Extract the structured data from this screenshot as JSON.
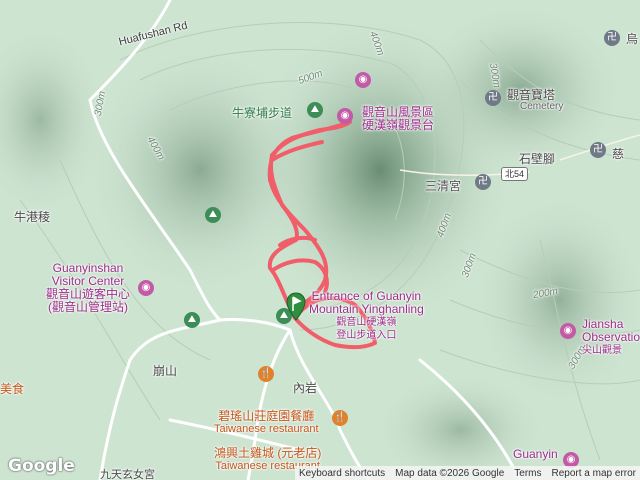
{
  "map": {
    "roads": [
      {
        "id": "huafushan",
        "label": "Huafushan Rd"
      },
      {
        "id": "north54",
        "label": "北54"
      }
    ],
    "contours": [
      "300m",
      "500m",
      "400m",
      "400m",
      "300m",
      "400m",
      "300m",
      "200m",
      "300m"
    ],
    "places": {
      "niugangleng": "牛港稜",
      "shibijiao": "石壁腳",
      "bengshan": "崩山",
      "neiyan": "內岩",
      "sanqinggong": "三清宮",
      "guanyin_baota": "觀音寶塔",
      "cemetery": "Cemetery",
      "niuliao_trail": "牛寮埔步道",
      "ci": "慈",
      "wu": "烏",
      "jiutian": "九天玄女宮",
      "mei": "美食"
    },
    "pois": {
      "scenic": [
        "觀音山風景區",
        "硬漢嶺觀景台"
      ],
      "visitor_center": [
        "Guanyinshan",
        "Visitor Center",
        "觀音山遊客中心",
        "(觀音山管理站)"
      ],
      "entrance": [
        "Entrance of Guanyin",
        "Mountain Yinghanling",
        "觀音山硬漢嶺",
        "登山步道入口"
      ],
      "jiansha": [
        "Jiansha",
        "Observatio",
        "尖山觀景"
      ],
      "guanyin_bottom": "Guanyin"
    },
    "restaurants": {
      "biyao": [
        "碧瑤山莊庭園餐廳",
        "Taiwanese restaurant"
      ],
      "hongxing": [
        "鴻興土雞城 (元老店)",
        "Taiwanese restaurant"
      ]
    },
    "icons": [
      "camera-icon",
      "hiking-icon",
      "temple-icon",
      "restaurant-icon",
      "map-pin-icon"
    ],
    "colors": {
      "track": "#f25d6a",
      "poi_text": "#9c2f8a",
      "food_text": "#c4561a",
      "terrain_base": "#cfe6d3",
      "terrain_dark": "#6d8f77"
    }
  },
  "footer": {
    "logo": "Google",
    "shortcuts": "Keyboard shortcuts",
    "data": "Map data ©2026 Google",
    "terms": "Terms",
    "report": "Report a map error"
  }
}
